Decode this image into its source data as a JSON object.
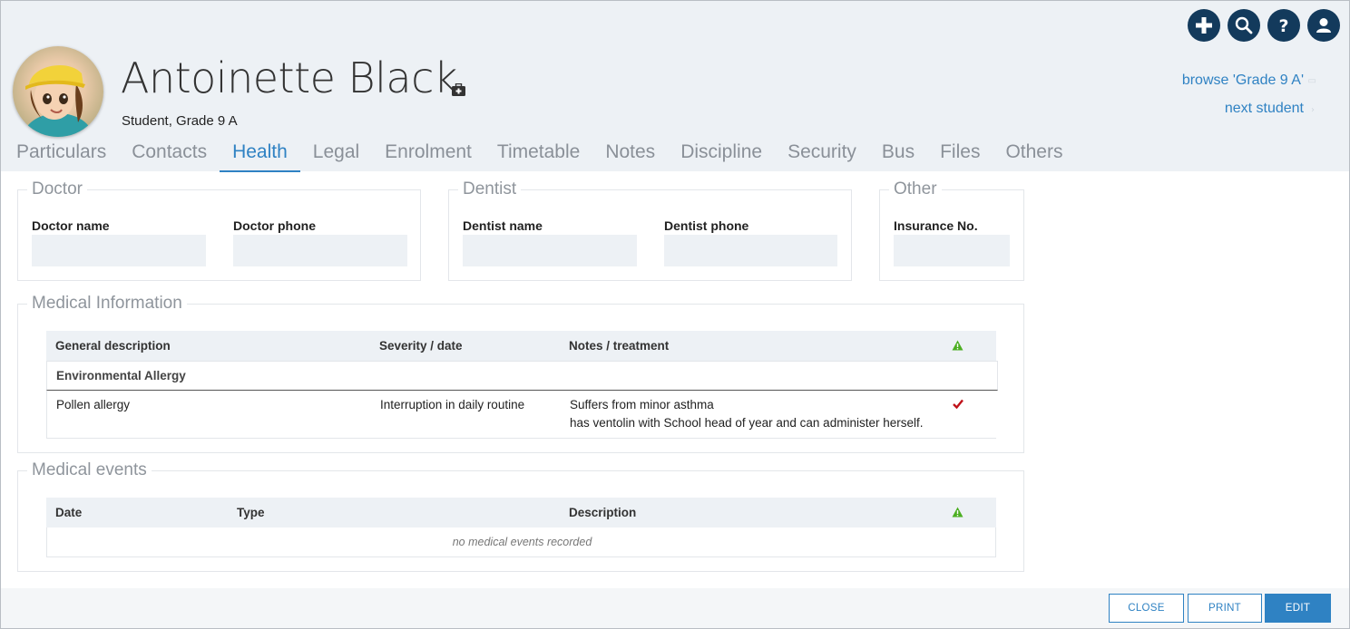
{
  "header": {
    "name": "Antoinette Black",
    "subtitle": "Student, Grade 9 A",
    "browse_link": "browse 'Grade 9 A'",
    "next_link": "next student",
    "icons": [
      "plus-icon",
      "search-icon",
      "help-icon",
      "user-icon"
    ]
  },
  "tabs": [
    {
      "label": "Particulars"
    },
    {
      "label": "Contacts"
    },
    {
      "label": "Health",
      "active": true
    },
    {
      "label": "Legal"
    },
    {
      "label": "Enrolment"
    },
    {
      "label": "Timetable"
    },
    {
      "label": "Notes"
    },
    {
      "label": "Discipline"
    },
    {
      "label": "Security"
    },
    {
      "label": "Bus"
    },
    {
      "label": "Files"
    },
    {
      "label": "Others"
    }
  ],
  "doctor": {
    "legend": "Doctor",
    "name_label": "Doctor name",
    "phone_label": "Doctor phone",
    "name_value": "",
    "phone_value": ""
  },
  "dentist": {
    "legend": "Dentist",
    "name_label": "Dentist name",
    "phone_label": "Dentist phone",
    "name_value": "",
    "phone_value": ""
  },
  "other": {
    "legend": "Other",
    "insurance_label": "Insurance No.",
    "insurance_value": ""
  },
  "medical_info": {
    "legend": "Medical Information",
    "headers": [
      "General description",
      "Severity / date",
      "Notes / treatment"
    ],
    "group": "Environmental Allergy",
    "row": {
      "description": "Pollen allergy",
      "severity": "Interruption in daily routine",
      "notes_line1": "Suffers from minor asthma",
      "notes_line2": "has ventolin with School head of year and can administer herself."
    }
  },
  "medical_events": {
    "legend": "Medical events",
    "headers": [
      "Date",
      "Type",
      "Description"
    ],
    "empty": "no medical events recorded"
  },
  "footer": {
    "close": "CLOSE",
    "print": "PRINT",
    "edit": "EDIT"
  },
  "colors": {
    "accent": "#2f82c3",
    "icon_dark": "#133a5c",
    "header_bg": "#edf1f5",
    "warning_green": "#4caf22",
    "check_red": "#c0121a"
  }
}
